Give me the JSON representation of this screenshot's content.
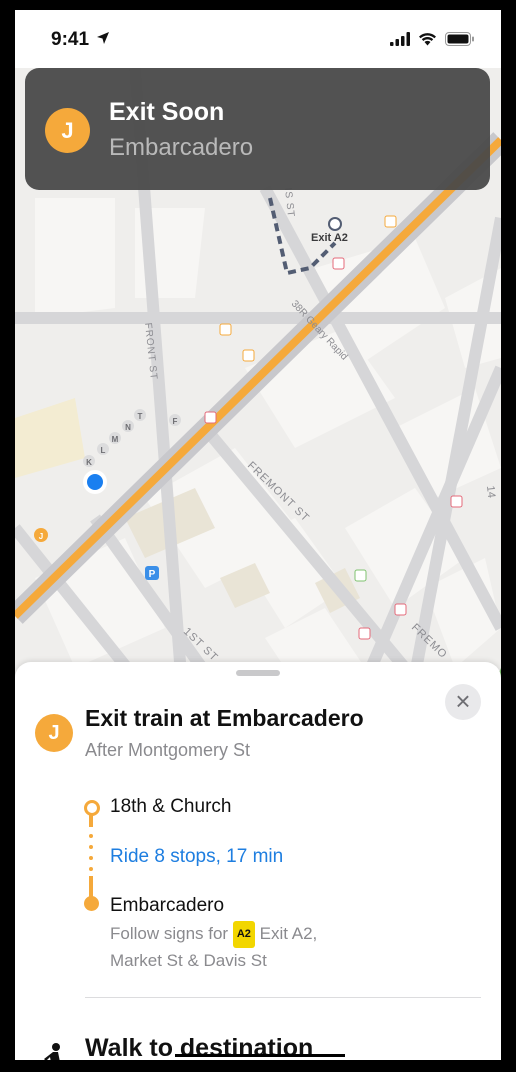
{
  "status_bar": {
    "time": "9:41"
  },
  "banner": {
    "line_badge": "J",
    "title": "Exit Soon",
    "subtitle": "Embarcadero"
  },
  "map": {
    "labels": {
      "exit": "Exit A2",
      "front_st": "FRONT ST",
      "is_st": "IS ST",
      "geary": "38R Geary Rapid",
      "fremont_st": "FREMONT ST",
      "fremo": "FREMO",
      "first_st": "1ST ST",
      "n14": "14",
      "parking": "P"
    },
    "line_markers": [
      "K",
      "L",
      "M",
      "N",
      "T",
      "F",
      "J"
    ]
  },
  "sheet": {
    "line_badge": "J",
    "title": "Exit train at Embarcadero",
    "subtitle": "After Montgomery St",
    "start_stop": "18th & Church",
    "ride": "Ride 8 stops, 17 min",
    "end_stop": "Embarcadero",
    "follow_prefix": "Follow signs for",
    "exit_badge": "A2",
    "follow_suffix": "Exit A2,",
    "follow_line2": "Market St & Davis St",
    "walk_label": "Walk to destination",
    "close_symbol": "×"
  },
  "colors": {
    "line_orange": "#f5a93b",
    "link_blue": "#1e7ee0",
    "location_blue": "#1a7ff0"
  },
  "icons": [
    "location-arrow-icon",
    "signal-icon",
    "wifi-icon",
    "battery-icon",
    "close-icon",
    "walking-person-icon",
    "parking-icon",
    "transit-entrance-icon"
  ]
}
